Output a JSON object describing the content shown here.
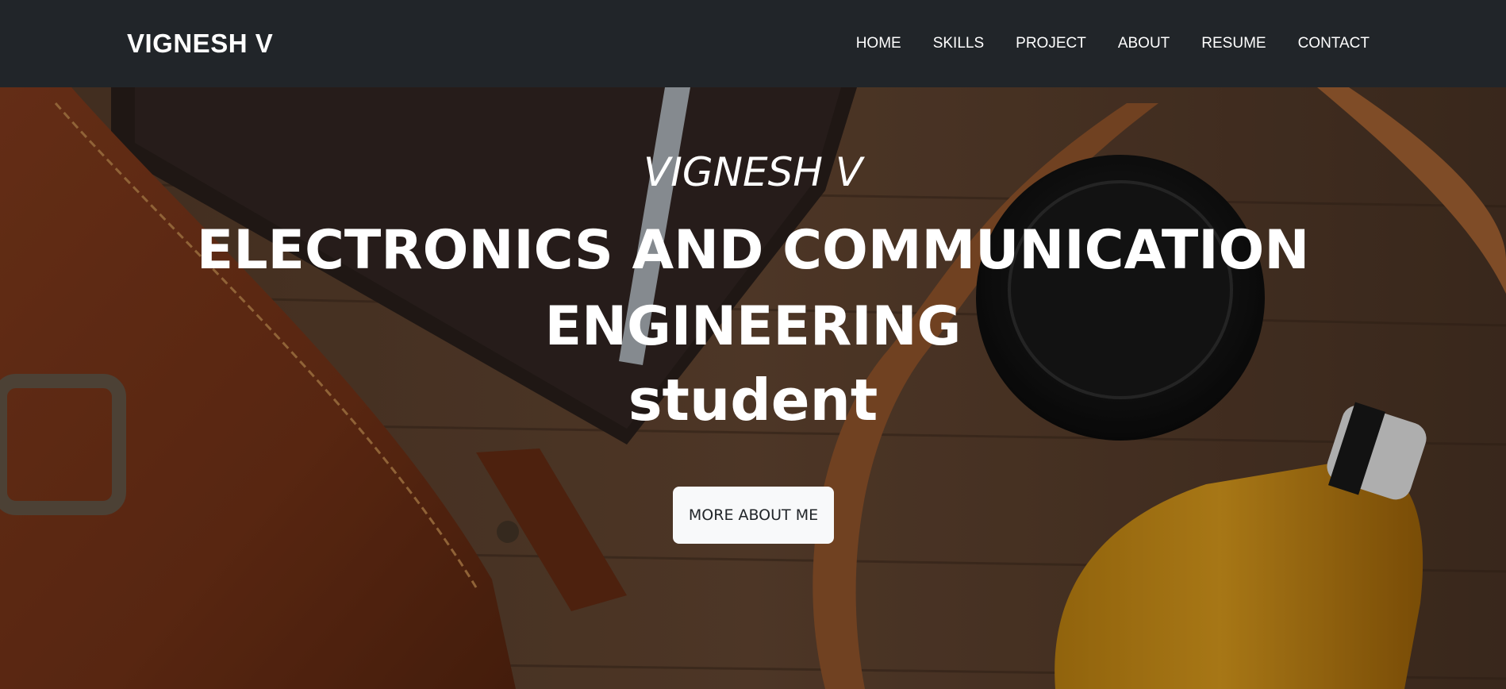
{
  "navbar": {
    "brand": "VIGNESH V",
    "links": [
      {
        "label": "HOME"
      },
      {
        "label": "SKILLS"
      },
      {
        "label": "PROJECT"
      },
      {
        "label": "ABOUT"
      },
      {
        "label": "RESUME"
      },
      {
        "label": "CONTACT"
      }
    ]
  },
  "hero": {
    "name": "VIGNESH V",
    "title": "ELECTRONICS AND COMMUNICATION ENGINEERING",
    "subtitle": "student",
    "button_label": "MORE ABOUT ME",
    "background": "photo of leather bag, notebook, pen, camera lens cap and orange juice bottle on wooden table"
  },
  "colors": {
    "navbar_bg": "#212529",
    "nav_text": "#ffffff",
    "button_bg": "#f8f9fa",
    "button_text": "#212529"
  }
}
